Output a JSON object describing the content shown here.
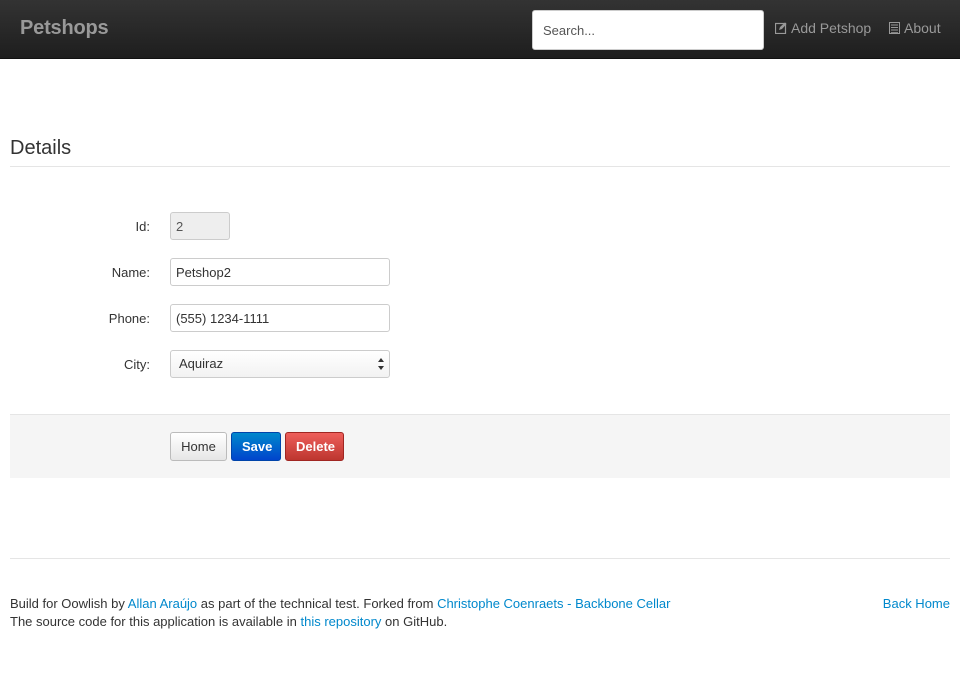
{
  "navbar": {
    "brand": "Petshops",
    "search_placeholder": "Search...",
    "add_label": "Add Petshop",
    "about_label": "About"
  },
  "page": {
    "title": "Details"
  },
  "form": {
    "id_label": "Id:",
    "id_value": "2",
    "name_label": "Name:",
    "name_value": "Petshop2",
    "phone_label": "Phone:",
    "phone_value": "(555) 1234-1111",
    "city_label": "City:",
    "city_value": "Aquiraz"
  },
  "actions": {
    "home_label": "Home",
    "save_label": "Save",
    "delete_label": "Delete"
  },
  "footer": {
    "line1_prefix": "Build for Oowlish by ",
    "author_link": "Allan Araújo",
    "line1_middle": " as part of the technical test. Forked from ",
    "fork_link": "Christophe Coenraets - Backbone Cellar",
    "line2_prefix": "The source code for this application is available in ",
    "repo_link": "this repository",
    "line2_suffix": " on GitHub.",
    "back_home": "Back Home"
  },
  "colors": {
    "navbar_bg": "#222222",
    "link": "#0088cc",
    "primary": "#0044cc",
    "danger": "#bd362f"
  }
}
